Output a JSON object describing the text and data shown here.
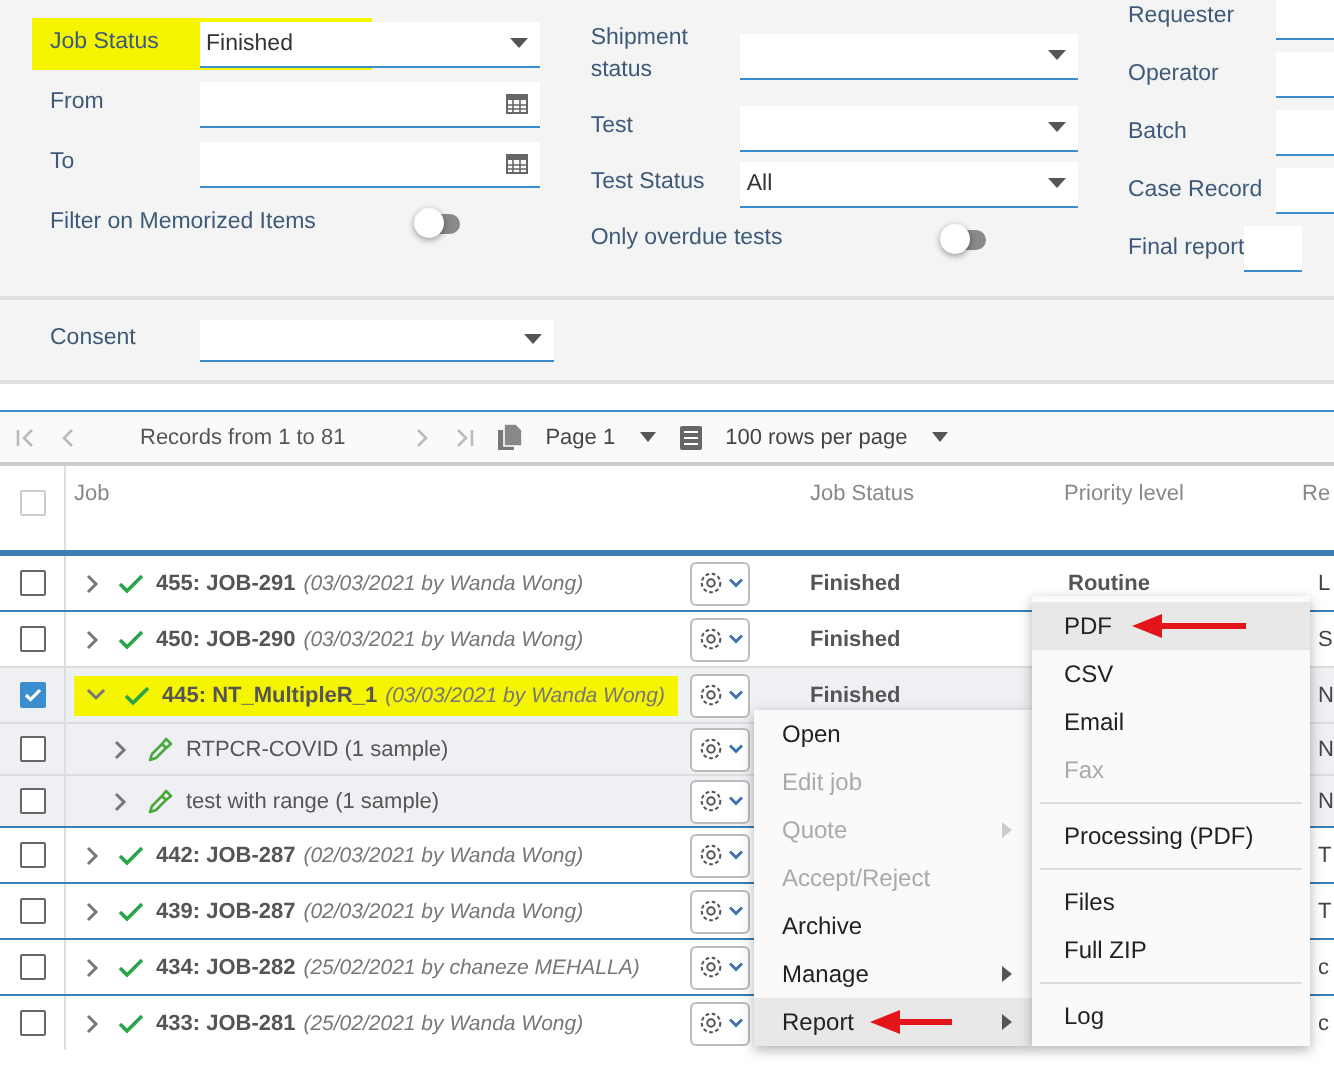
{
  "filters": {
    "columns": [
      {
        "fields": [
          {
            "kind": "select",
            "label": "Job Status",
            "value": "Finished",
            "highlighted": true
          },
          {
            "kind": "date",
            "label": "From"
          },
          {
            "kind": "date",
            "label": "To"
          },
          {
            "kind": "toggle",
            "label": "Filter on Memorized Items",
            "on": false
          }
        ]
      },
      {
        "fields": [
          {
            "kind": "select",
            "label": "Shipment status"
          },
          {
            "kind": "select",
            "label": "Test"
          },
          {
            "kind": "select",
            "label": "Test Status",
            "value": "All"
          },
          {
            "kind": "toggle",
            "label": "Only overdue tests",
            "on": false
          }
        ]
      },
      {
        "fields": [
          {
            "kind": "text",
            "label": "Requester"
          },
          {
            "kind": "text",
            "label": "Operator"
          },
          {
            "kind": "text",
            "label": "Batch"
          },
          {
            "kind": "text",
            "label": "Case Record"
          },
          {
            "kind": "text",
            "label": "Final report"
          }
        ]
      }
    ]
  },
  "consent": {
    "label": "Consent"
  },
  "pager": {
    "records": "Records from 1 to 81",
    "page": "Page 1",
    "rows_per_page": "100 rows per page"
  },
  "table": {
    "select_all_checked": false,
    "columns": [
      "Job",
      "Job Status",
      "Priority level",
      "Re"
    ],
    "rows": [
      {
        "kind": "job",
        "checked": false,
        "expanded": false,
        "highlighted": false,
        "title": "455: JOB-291",
        "meta": "(03/03/2021 by Wanda Wong)",
        "status": "Finished",
        "priority": "Routine",
        "column_6": "L"
      },
      {
        "kind": "job",
        "checked": false,
        "expanded": false,
        "highlighted": false,
        "title": "450: JOB-290",
        "meta": "(03/03/2021 by Wanda Wong)",
        "status": "Finished",
        "column_6": "S"
      },
      {
        "kind": "job",
        "checked": true,
        "expanded": true,
        "highlighted": true,
        "title": "445: NT_MultipleR_1",
        "meta": "(03/03/2021 by Wanda Wong)",
        "status": "Finished",
        "column_6": "N"
      },
      {
        "kind": "test",
        "checked": false,
        "expanded": false,
        "highlighted": false,
        "title": "RTPCR-COVID (1 sample)",
        "column_6": "N"
      },
      {
        "kind": "test",
        "checked": false,
        "expanded": false,
        "highlighted": false,
        "title": "test with range (1 sample)",
        "column_6": "N"
      },
      {
        "kind": "job",
        "checked": false,
        "expanded": false,
        "highlighted": false,
        "title": "442: JOB-287",
        "meta": "(02/03/2021 by Wanda Wong)",
        "column_6": "T"
      },
      {
        "kind": "job",
        "checked": false,
        "expanded": false,
        "highlighted": false,
        "title": "439: JOB-287",
        "meta": "(02/03/2021 by Wanda Wong)",
        "column_6": "T"
      },
      {
        "kind": "job",
        "checked": false,
        "expanded": false,
        "highlighted": false,
        "title": "434: JOB-282",
        "meta": "(25/02/2021 by chaneze MEHALLA)",
        "column_6": "c"
      },
      {
        "kind": "job",
        "checked": false,
        "expanded": false,
        "highlighted": false,
        "title": "433: JOB-281",
        "meta": "(25/02/2021 by Wanda Wong)",
        "column_6": "c"
      }
    ]
  },
  "context_menu": {
    "items": [
      {
        "label": "Open",
        "disabled": false,
        "submenu": false,
        "selected": false,
        "annotated": false
      },
      {
        "label": "Edit job",
        "disabled": true,
        "submenu": false,
        "selected": false,
        "annotated": false
      },
      {
        "label": "Quote",
        "disabled": true,
        "submenu": true,
        "selected": false,
        "annotated": false
      },
      {
        "label": "Accept/Reject",
        "disabled": true,
        "submenu": false,
        "selected": false,
        "annotated": false
      },
      {
        "label": "Archive",
        "disabled": false,
        "submenu": false,
        "selected": false,
        "annotated": false
      },
      {
        "label": "Manage",
        "disabled": false,
        "submenu": true,
        "selected": false,
        "annotated": false
      },
      {
        "label": "Report",
        "disabled": false,
        "submenu": true,
        "selected": true,
        "annotated": true
      }
    ]
  },
  "report_submenu": {
    "items": [
      {
        "kind": "item",
        "label": "PDF",
        "disabled": false,
        "selected": true,
        "annotated": true
      },
      {
        "kind": "item",
        "label": "CSV",
        "disabled": false,
        "selected": false,
        "annotated": false
      },
      {
        "kind": "item",
        "label": "Email",
        "disabled": false,
        "selected": false,
        "annotated": false
      },
      {
        "kind": "item",
        "label": "Fax",
        "disabled": true,
        "selected": false,
        "annotated": false
      },
      {
        "kind": "divider"
      },
      {
        "kind": "item",
        "label": "Processing (PDF)",
        "disabled": false,
        "selected": false,
        "annotated": false
      },
      {
        "kind": "divider"
      },
      {
        "kind": "item",
        "label": "Files",
        "disabled": false,
        "selected": false,
        "annotated": false
      },
      {
        "kind": "item",
        "label": "Full ZIP",
        "disabled": false,
        "selected": false,
        "annotated": false
      },
      {
        "kind": "divider"
      },
      {
        "kind": "item",
        "label": "Log",
        "disabled": false,
        "selected": false,
        "annotated": false
      }
    ]
  }
}
